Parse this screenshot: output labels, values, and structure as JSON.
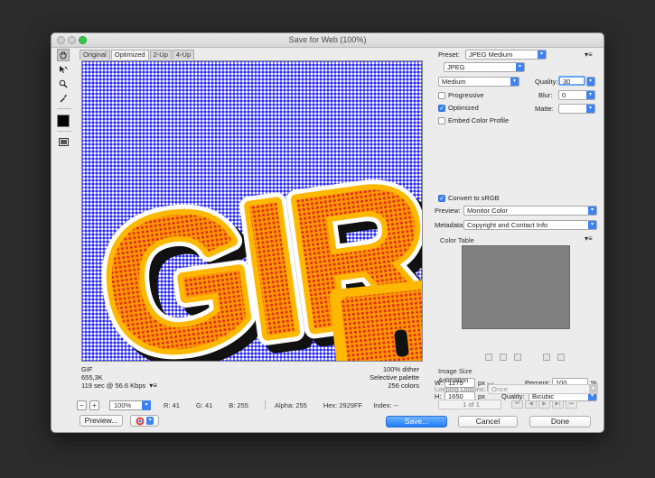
{
  "window": {
    "title": "Save for Web (100%)"
  },
  "tools": [
    "hand-icon",
    "slice-select-icon",
    "zoom-icon",
    "eyedropper-icon",
    "eyedropper-color-swatch",
    "toggle-slices-icon"
  ],
  "tabs": [
    "Original",
    "Optimized",
    "2-Up",
    "4-Up"
  ],
  "canvas": {
    "text": "GIR"
  },
  "info": {
    "format": "GIF",
    "size": "655,3K",
    "time": "119 sec @ 56.6 Kbps",
    "dither": "100% dither",
    "palette": "Selective palette",
    "colors": "256 colors"
  },
  "status": {
    "zoom": "100%",
    "r": "R: 41",
    "g": "G: 41",
    "b": "B: 255",
    "alpha": "Alpha: 255",
    "hex": "Hex: 2929FF",
    "index": "Index: --"
  },
  "buttons": {
    "preview": "Preview...",
    "save": "Save...",
    "cancel": "Cancel",
    "done": "Done"
  },
  "settings": {
    "preset_label": "Preset:",
    "preset_value": "JPEG Medium",
    "format": "JPEG",
    "compression": "Medium",
    "quality_label": "Quality:",
    "quality_value": "30",
    "blur_label": "Blur:",
    "blur_value": "0",
    "matte_label": "Matte:",
    "progressive": "Progressive",
    "optimized": "Optimized",
    "embed": "Embed Color Profile",
    "convert": "Convert to sRGB",
    "preview_label": "Preview:",
    "preview_value": "Monitor Color",
    "metadata_label": "Metadata:",
    "metadata_value": "Copyright and Contact Info",
    "color_table": "Color Table"
  },
  "image_size": {
    "title": "Image Size",
    "w_label": "W:",
    "w_value": "1275",
    "h_label": "H:",
    "h_value": "1650",
    "unit": "px",
    "percent_label": "Percent:",
    "percent_value": "100",
    "percent_unit": "%",
    "quality_label": "Quality:",
    "quality_value": "Bicubic"
  },
  "animation": {
    "title": "Animation",
    "looping_label": "Looping Options:",
    "looping_value": "Once",
    "frame": "1 of 1"
  },
  "colors": {
    "canvas_blue": "#2929ff",
    "accent": "#3b82f6",
    "letter_red": "#e63c22",
    "letter_yellow": "#ffb800"
  }
}
